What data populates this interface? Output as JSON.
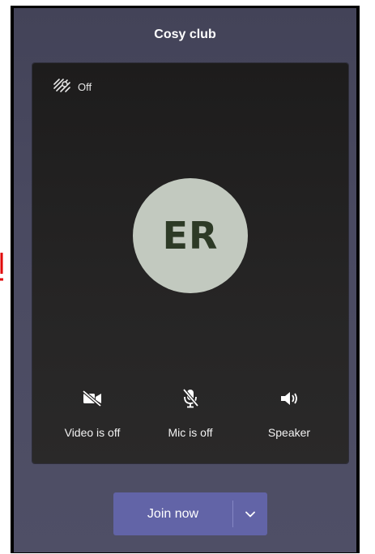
{
  "window": {
    "title": "Cosy club"
  },
  "preview": {
    "background_effects": {
      "label": "Off",
      "icon": "background-effects-icon"
    },
    "avatar": {
      "initials": "ER",
      "color": "#c2c9bf"
    }
  },
  "controls": {
    "video": {
      "label": "Video is off",
      "icon": "video-off-icon"
    },
    "mic": {
      "label": "Mic is off",
      "icon": "mic-off-icon"
    },
    "speaker": {
      "label": "Speaker",
      "icon": "speaker-icon"
    }
  },
  "join": {
    "label": "Join now",
    "icon": "chevron-down-icon",
    "color": "#6264a7"
  }
}
